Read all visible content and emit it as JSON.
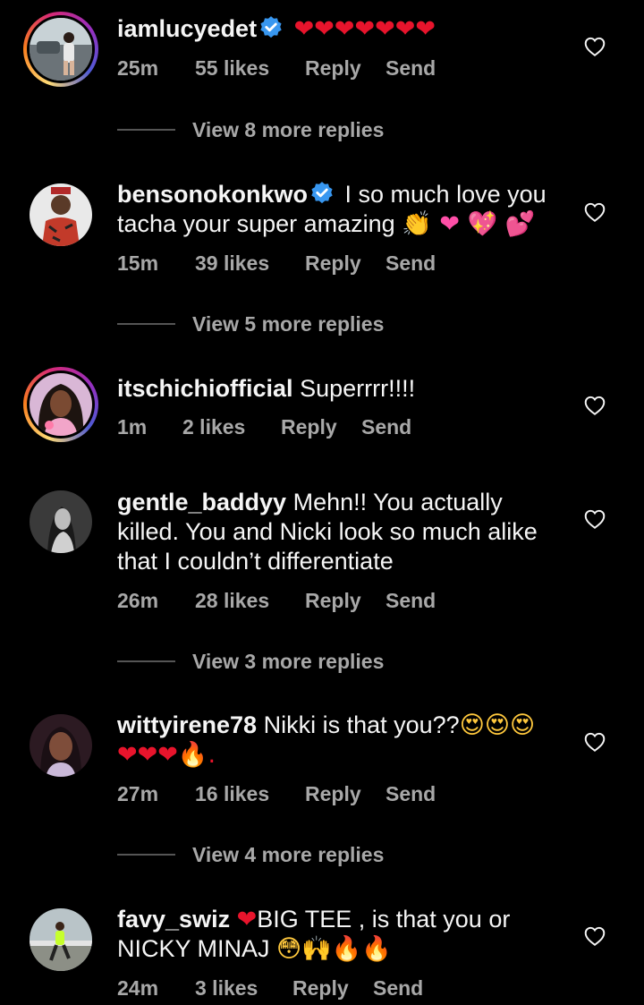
{
  "colors": {
    "background": "#000000",
    "text": "#f5f5f5",
    "secondary": "#a8a8a8",
    "verified_blue": "#3897f0"
  },
  "comments": [
    {
      "username": "iamlucyedet",
      "verified": true,
      "story_ring": true,
      "text": "",
      "emoji_text": "❤❤❤❤❤❤❤",
      "time": "25m",
      "likes": "55 likes",
      "reply": "Reply",
      "send": "Send",
      "view_replies": "View 8 more replies",
      "icon": "heart-outline-icon"
    },
    {
      "username": "bensonokonkwo",
      "verified": true,
      "story_ring": false,
      "text": "I so much love you tacha your super amazing",
      "emoji_text": "👏 ❤ 💖 💕",
      "time": "15m",
      "likes": "39 likes",
      "reply": "Reply",
      "send": "Send",
      "view_replies": "View 5 more replies",
      "icon": "heart-outline-icon"
    },
    {
      "username": "itschichiofficial",
      "verified": false,
      "story_ring": true,
      "text": "Superrrr!!!!",
      "emoji_text": "",
      "time": "1m",
      "likes": "2 likes",
      "reply": "Reply",
      "send": "Send",
      "view_replies": "",
      "icon": "heart-outline-icon"
    },
    {
      "username": "gentle_baddyy",
      "verified": false,
      "story_ring": false,
      "text": "Mehn!! You actually killed. You and Nicki look so much alike that I couldn’t differentiate",
      "emoji_text": "",
      "time": "26m",
      "likes": "28 likes",
      "reply": "Reply",
      "send": "Send",
      "view_replies": "View 3 more replies",
      "icon": "heart-outline-icon"
    },
    {
      "username": "wittyirene78",
      "verified": false,
      "story_ring": false,
      "text": "Nikki is that you??",
      "emoji_text": "😍😍😍",
      "emoji_text_2": "❤❤❤🔥.",
      "time": "27m",
      "likes": "16 likes",
      "reply": "Reply",
      "send": "Send",
      "view_replies": "View 4 more replies",
      "icon": "heart-outline-icon"
    },
    {
      "username": "favy_swiz",
      "verified": false,
      "story_ring": false,
      "text_pre": "❤",
      "text": "BIG TEE , is that you or NICKY MINAJ",
      "emoji_text": "😳🙌🔥🔥",
      "time": "24m",
      "likes": "3 likes",
      "reply": "Reply",
      "send": "Send",
      "view_replies": "",
      "icon": "heart-outline-icon"
    }
  ]
}
